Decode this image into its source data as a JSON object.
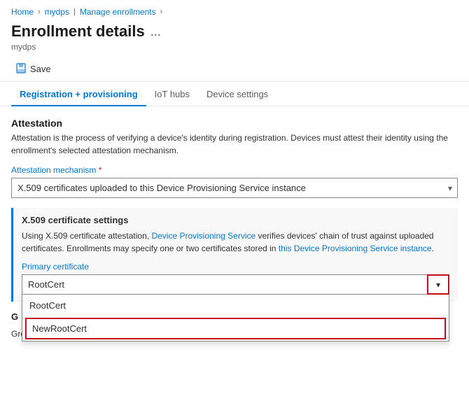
{
  "breadcrumb": {
    "items": [
      "Home",
      "mydps",
      "Manage enrollments"
    ],
    "separators": [
      ">",
      "|",
      ">"
    ]
  },
  "page": {
    "title": "Enrollment details",
    "ellipsis": "...",
    "subtitle": "mydps"
  },
  "toolbar": {
    "save_label": "Save",
    "save_icon": "💾"
  },
  "tabs": [
    {
      "label": "Registration + provisioning",
      "active": true
    },
    {
      "label": "IoT hubs",
      "active": false
    },
    {
      "label": "Device settings",
      "active": false
    }
  ],
  "attestation": {
    "section_title": "Attestation",
    "description": "Attestation is the process of verifying a device's identity during registration. Devices must attest their identity using the enrollment's selected attestation mechanism.",
    "mechanism_label": "Attestation mechanism",
    "mechanism_required": true,
    "mechanism_value": "X.509 certificates uploaded to this Device Provisioning Service instance",
    "cert_settings": {
      "title": "X.509 certificate settings",
      "description": "Using X.509 certificate attestation, Device Provisioning Service verifies devices' chain of trust against uploaded certificates. Enrollments may specify one or two certificates stored in this Device Provisioning Service instance.",
      "primary_cert_label": "Primary certificate",
      "primary_cert_value": "RootCert",
      "dropdown_open": true,
      "dropdown_items": [
        {
          "label": "RootCert",
          "highlighted": false
        },
        {
          "label": "NewRootCert",
          "highlighted": true,
          "outlined": true
        }
      ]
    }
  },
  "group": {
    "label": "G",
    "description": "Group name uniquely identifies the enrollment group and is used to find device registration records."
  }
}
